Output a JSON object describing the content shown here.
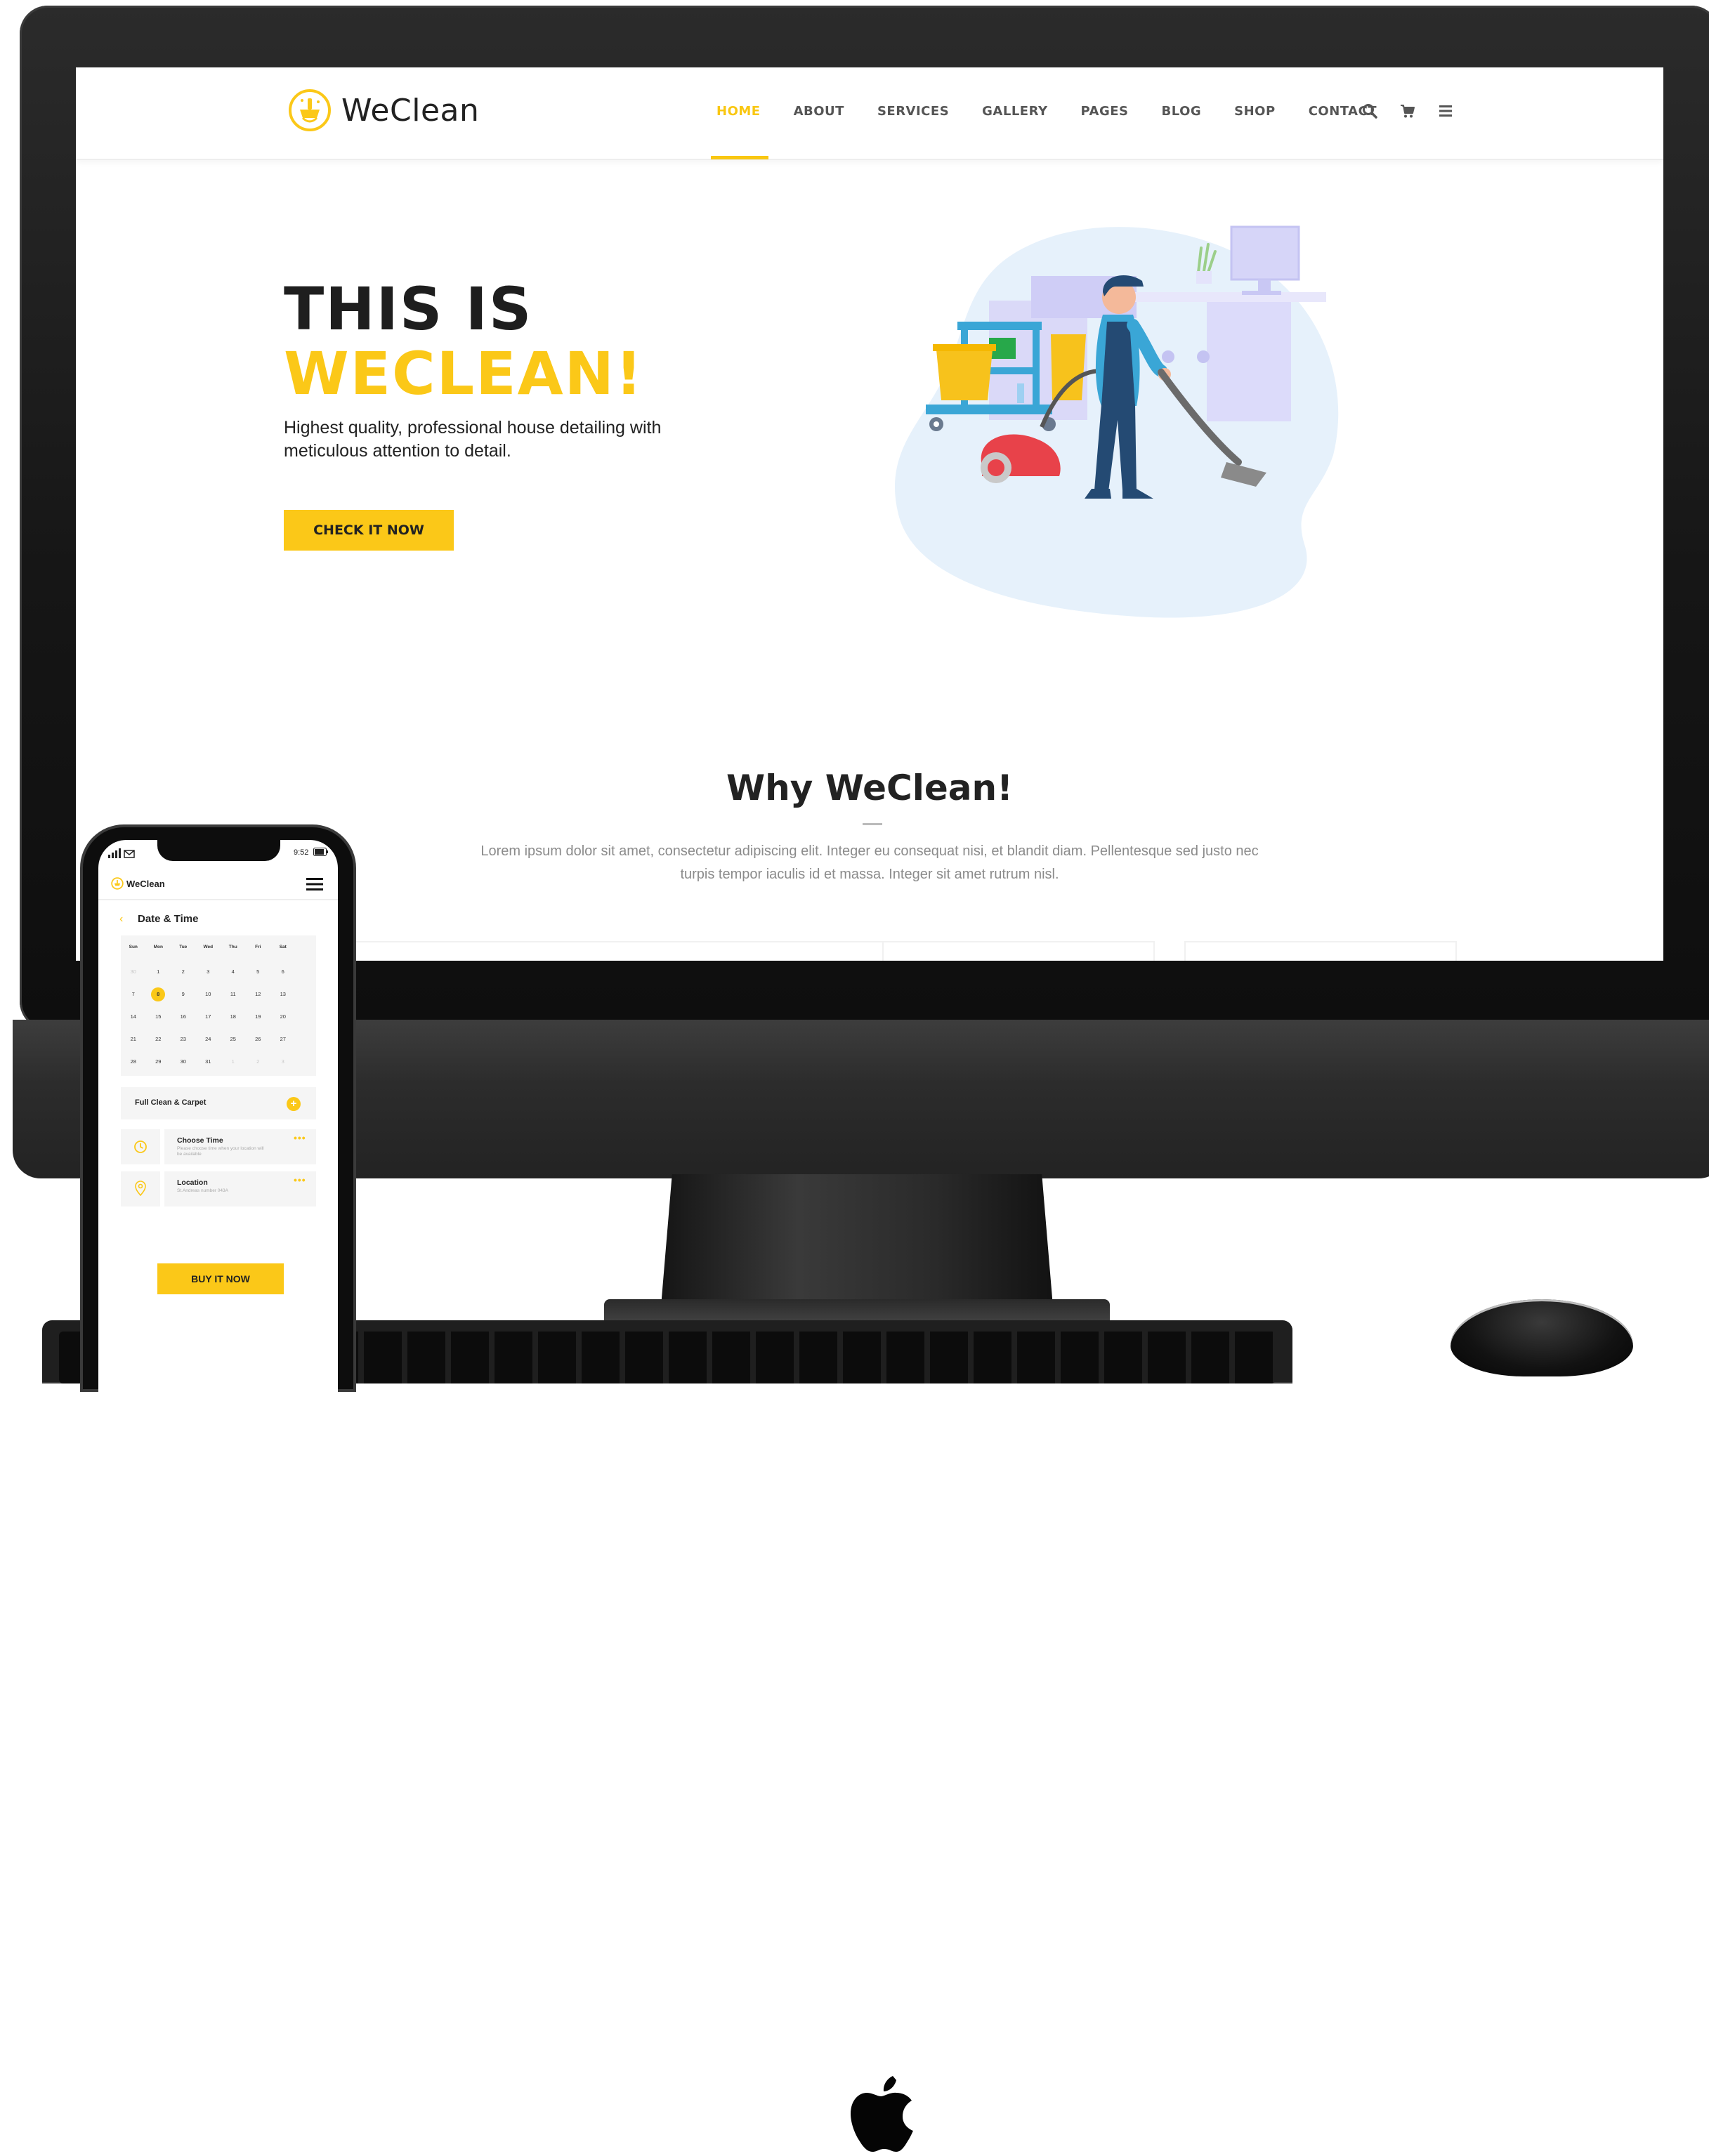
{
  "site": {
    "brand": "WeClean",
    "nav": [
      "HOME",
      "ABOUT",
      "SERVICES",
      "GALLERY",
      "PAGES",
      "BLOG",
      "SHOP",
      "CONTACT"
    ],
    "active_nav": "HOME",
    "icons": [
      "search-icon",
      "cart-icon",
      "menu-icon"
    ],
    "hero": {
      "title_line1": "THIS IS",
      "title_line2": "WECLEAN!",
      "description": "Highest quality, professional house detailing with meticulous attention to detail.",
      "cta": "CHECK IT NOW"
    },
    "why": {
      "title": "Why WeClean!",
      "text": "Lorem ipsum dolor sit amet, consectetur adipiscing elit. Integer eu consequat nisi, et blandit diam. Pellentesque sed justo nec turpis tempor iaculis id et massa. Integer sit amet rutrum nisl."
    }
  },
  "phone": {
    "status_time": "9:52",
    "brand": "WeClean",
    "section_title": "Date & Time",
    "calendar": {
      "weekdays": [
        "Sun",
        "Mon",
        "Tue",
        "Wed",
        "Thu",
        "Fri",
        "Sat"
      ],
      "weeks": [
        [
          "30",
          "1",
          "2",
          "3",
          "4",
          "5",
          "6"
        ],
        [
          "7",
          "8",
          "9",
          "10",
          "11",
          "12",
          "13"
        ],
        [
          "14",
          "15",
          "16",
          "17",
          "18",
          "19",
          "20"
        ],
        [
          "21",
          "22",
          "23",
          "24",
          "25",
          "26",
          "27"
        ],
        [
          "28",
          "29",
          "30",
          "31",
          "1",
          "2",
          "3"
        ]
      ],
      "selected": "8"
    },
    "service": "Full Clean & Carpet",
    "time_option": {
      "title": "Choose Time",
      "subtitle": "Please choose time when your location will be available"
    },
    "location_option": {
      "title": "Location",
      "subtitle": "St.Andreas number 043A"
    },
    "buy_button": "BUY IT NOW"
  },
  "colors": {
    "accent": "#fbc818",
    "text_dark": "#1e1e1e",
    "text_muted": "#8b8b8b"
  }
}
